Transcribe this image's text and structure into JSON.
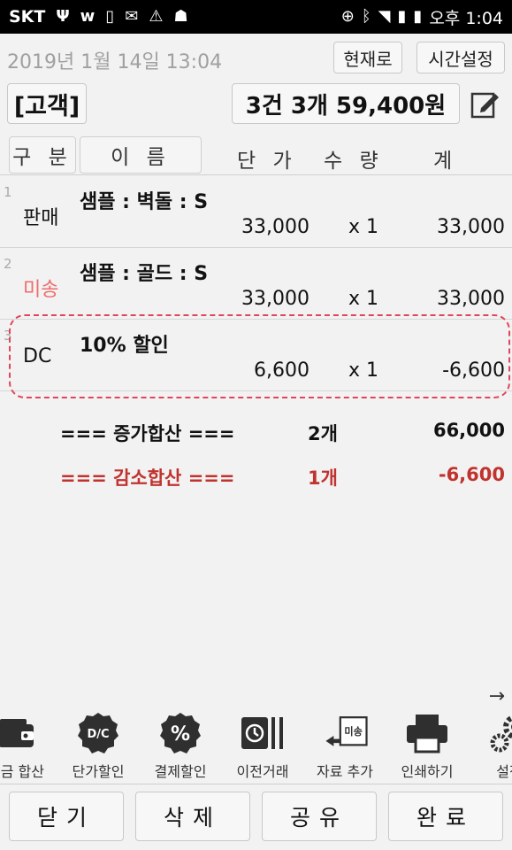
{
  "status_bar": {
    "carrier": "SKT",
    "time": "오후 1:04"
  },
  "header": {
    "datetime": "2019년 1월 14일 13:04",
    "now_button": "현재로",
    "time_setting_button": "시간설정"
  },
  "customer": {
    "button_label": "[고객]",
    "summary": "3건 3개 59,400원"
  },
  "table": {
    "columns": {
      "type": "구 분",
      "name": "이 름",
      "price": "단 가",
      "qty": "수 량",
      "total": "계"
    },
    "rows": [
      {
        "num": "1",
        "category": "판매",
        "name": "샘플 : 벽돌 : S",
        "price": "33,000",
        "qty": "x 1",
        "amount": "33,000"
      },
      {
        "num": "2",
        "category": "미송",
        "name": "샘플 : 골드 : S",
        "price": "33,000",
        "qty": "x 1",
        "amount": "33,000"
      },
      {
        "num": "3",
        "category": "DC",
        "name": "10% 할인",
        "price": "6,600",
        "qty": "x 1",
        "amount": "-6,600"
      }
    ]
  },
  "summary": {
    "increase": {
      "label": "=== 증가합산 ===",
      "count": "2개",
      "value": "66,000"
    },
    "decrease": {
      "label": "=== 감소합산 ===",
      "count": "1개",
      "value": "-6,600"
    }
  },
  "toolbar": {
    "items": [
      {
        "label": "수금 합산",
        "icon": "wallet-icon"
      },
      {
        "label": "단가할인",
        "icon": "dc-badge-icon",
        "badge_text": "D/C"
      },
      {
        "label": "결제할인",
        "icon": "percent-badge-icon",
        "badge_text": "%"
      },
      {
        "label": "이전거래",
        "icon": "history-icon"
      },
      {
        "label": "자료 추가",
        "icon": "add-data-icon",
        "badge_text": "미송"
      },
      {
        "label": "인쇄하기",
        "icon": "printer-icon"
      },
      {
        "label": "설정",
        "icon": "gear-icon"
      }
    ]
  },
  "bottom_buttons": {
    "close": "닫기",
    "delete": "삭제",
    "share": "공유",
    "complete": "완료"
  },
  "colors": {
    "accent_red": "#c0332e",
    "category_red": "#ef6b6b",
    "highlight_border": "#e0465a",
    "icon_dark": "#2f2f2f"
  }
}
